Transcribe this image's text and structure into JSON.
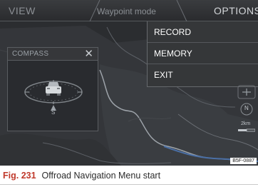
{
  "topbar": {
    "view_label": "VIEW",
    "mode_title": "Waypoint mode",
    "options_label": "OPTIONS"
  },
  "compass": {
    "title": "COMPASS",
    "close_symbol": "✕",
    "direction_label": "S"
  },
  "options_menu": {
    "items": [
      {
        "label": "RECORD"
      },
      {
        "label": "MEMORY"
      },
      {
        "label": "EXIT"
      }
    ]
  },
  "side_controls": {
    "north_label": "N",
    "scale_label": "2km"
  },
  "image_code": "B5F-0887",
  "caption": {
    "figure": "Fig. 231",
    "text": "Offroad Navigation Menu start"
  },
  "colors": {
    "caption_figure": "#c0392b",
    "menu_background": "#353739",
    "screen_background": "#2a2c2f"
  }
}
